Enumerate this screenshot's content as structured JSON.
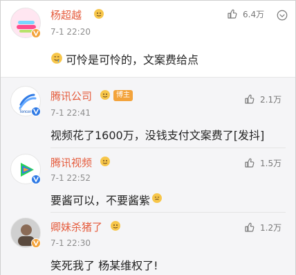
{
  "main_comment": {
    "author": "杨超越",
    "time": "7-1 22:20",
    "text": "可怜是可怜的，文案费给点",
    "likes": "6.4万",
    "badges": {
      "verified_color": "#f3a33b",
      "emoji_leading": "drooling-face"
    }
  },
  "replies": [
    {
      "author": "腾讯公司",
      "level_badge": "博主",
      "time": "7-1 22:41",
      "text": "视频花了1600万，没钱支付文案费了[发抖]",
      "likes": "2.1万",
      "verified_color": "#2f7ae5",
      "avatar_label": "Tencent"
    },
    {
      "author": "腾讯视频",
      "time": "7-1 22:52",
      "text": "要酱可以，不要酱紫",
      "likes": "1.5万",
      "verified_color": "#2f7ae5"
    },
    {
      "author": "卿妹杀猪了",
      "time": "7-1 22:30",
      "text": "笑死我了 杨某维权了!",
      "likes": "1.2万",
      "verified_color": "#f3a33b"
    }
  ],
  "colors": {
    "author_name": "#e55b3c",
    "reply_bg": "#f5f5f7"
  }
}
